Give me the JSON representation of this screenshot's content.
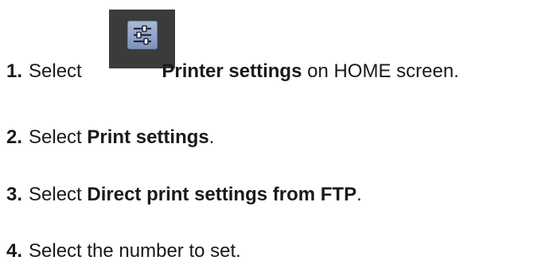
{
  "steps": [
    {
      "number": "1.",
      "before": "Select ",
      "icon": "printer-settings-icon",
      "bold": "Printer settings",
      "after": " on HOME screen."
    },
    {
      "number": "2.",
      "before": "Select ",
      "bold": "Print settings",
      "after": "."
    },
    {
      "number": "3.",
      "before": "Select ",
      "bold": "Direct print settings from FTP",
      "after": "."
    },
    {
      "number": "4.",
      "text": "Select the number to set."
    }
  ],
  "colors": {
    "text": "#1a1a1a",
    "icon_background": "#3a3b3b",
    "icon_tile": "#9aaacb"
  }
}
